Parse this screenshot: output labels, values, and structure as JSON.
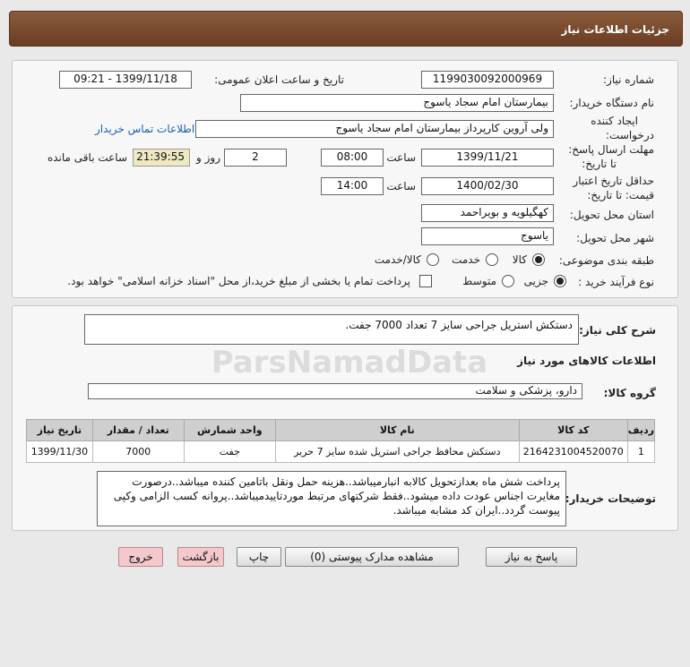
{
  "header": {
    "title": "جزئیات اطلاعات نیاز"
  },
  "form": {
    "need_number_label": "شماره نیاز:",
    "need_number": "1199030092000969",
    "announce_label": "تاریخ و ساعت اعلان عمومی:",
    "announce_value": "1399/11/18 - 09:21",
    "buyer_org_label": "نام دستگاه خریدار:",
    "buyer_org": "بیمارستان امام سجاد یاسوج",
    "requester_label_1": "ایجاد کننده",
    "requester_label_2": "درخواست:",
    "requester": "ولی آروین کارپرداز بیمارستان امام سجاد یاسوج",
    "contact_link": "اطلاعات تماس خریدار",
    "deadline_label_1": "مهلت ارسال پاسخ:",
    "deadline_label_2": "تا تاریخ:",
    "deadline_date": "1399/11/21",
    "time_label": "ساعت",
    "deadline_time": "08:00",
    "days_value": "2",
    "days_label": "روز و",
    "remaining_time": "21:39:55",
    "remaining_label": "ساعت باقی مانده",
    "validity_label_1": "حداقل تاریخ اعتبار",
    "validity_label_2": "قیمت: تا تاریخ:",
    "validity_date": "1400/02/30",
    "validity_time": "14:00",
    "province_label": "استان محل تحویل:",
    "province": "کهگیلویه و بویراحمد",
    "city_label": "شهر محل تحویل:",
    "city": "یاسوج",
    "category_label": "طبقه بندی موضوعی:",
    "category_options": [
      "کالا",
      "خدمت",
      "کالا/خدمت"
    ],
    "process_label": "نوع فرآیند خرید :",
    "process_options": [
      "جزیی",
      "متوسط"
    ],
    "payment_note": "پرداخت تمام یا بخشی از مبلغ خرید،از محل \"اسناد خزانه اسلامی\" خواهد بود."
  },
  "summary": {
    "label": "شرح کلی نیاز:",
    "value": "دستکش استریل جراحی سایز 7 تعداد 7000 جفت."
  },
  "goods": {
    "section_title": "اطلاعات کالاهای مورد نیاز",
    "group_label": "گروه کالا:",
    "group_value": "دارو، پزشکی و سلامت",
    "columns": [
      "ردیف",
      "کد کالا",
      "نام کالا",
      "واحد شمارش",
      "تعداد / مقدار",
      "تاریخ نیاز"
    ],
    "rows": [
      [
        "1",
        "2164231004520070",
        "دستکش محافظ جراحی استریل شده سایز 7 حریر",
        "جفت",
        "7000",
        "1399/11/30"
      ]
    ]
  },
  "notes": {
    "label": "توضیحات خریدار:",
    "text": "پرداخت شش ماه بعدازتحویل کالابه انبارمیباشد..هزینه حمل ونقل باتامین کننده میباشد..درصورت مغایرت اجناس عودت داده میشود..فقط شرکتهای مرتبط موردتاییدمیباشد..پروانه کسب الزامی وکپی پیوست گردد..ایران کد مشابه میباشد."
  },
  "buttons": {
    "reply": "پاسخ به نیاز",
    "view_docs": "مشاهده مدارک پیوستی (0)",
    "print": "چاپ",
    "back": "بازگشت",
    "exit": "خروج"
  },
  "watermark": "ParsNamadData",
  "colors": {
    "header": "#7a4a2e",
    "link": "#1a5fb4",
    "remaining_bg": "#efe9c2",
    "pink_button": "#f4c8cc"
  }
}
